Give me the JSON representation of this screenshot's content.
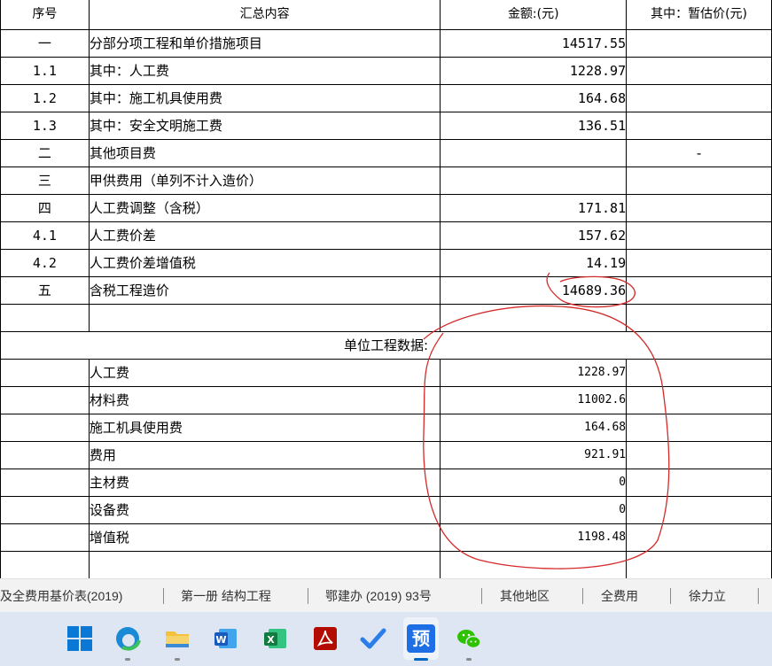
{
  "table": {
    "headers": [
      "序号",
      "汇总内容",
      "金额:(元)",
      "其中：暂估价(元)"
    ],
    "rows": [
      {
        "num": "一",
        "desc": "分部分项工程和单价措施项目",
        "amount": "14517.55",
        "est": ""
      },
      {
        "num": "1.1",
        "desc": "其中：人工费",
        "amount": "1228.97",
        "est": ""
      },
      {
        "num": "1.2",
        "desc": "其中：施工机具使用费",
        "amount": "164.68",
        "est": ""
      },
      {
        "num": "1.3",
        "desc": "其中：安全文明施工费",
        "amount": "136.51",
        "est": ""
      },
      {
        "num": "二",
        "desc": "其他项目费",
        "amount": "",
        "est": "-"
      },
      {
        "num": "三",
        "desc": "甲供费用（单列不计入造价）",
        "amount": "",
        "est": ""
      },
      {
        "num": "四",
        "desc": "人工费调整（含税）",
        "amount": "171.81",
        "est": ""
      },
      {
        "num": "4.1",
        "desc": "人工费价差",
        "amount": "157.62",
        "est": ""
      },
      {
        "num": "4.2",
        "desc": "人工费价差增值税",
        "amount": "14.19",
        "est": ""
      },
      {
        "num": "五",
        "desc": "含税工程造价",
        "amount": "14689.36",
        "est": ""
      }
    ],
    "unit_title": "单位工程数据:",
    "unit_rows": [
      {
        "desc": "人工费",
        "amount": "1228.97"
      },
      {
        "desc": "材料费",
        "amount": "11002.6"
      },
      {
        "desc": "施工机具使用费",
        "amount": "164.68"
      },
      {
        "desc": "费用",
        "amount": "921.91"
      },
      {
        "desc": "主材费",
        "amount": "0"
      },
      {
        "desc": "设备费",
        "amount": "0"
      },
      {
        "desc": "增值税",
        "amount": "1198.48"
      }
    ]
  },
  "status_bar": {
    "items": [
      "及全费用基价表(2019)",
      "第一册 结构工程",
      "鄂建办 (2019) 93号",
      "其他地区",
      "全费用",
      "徐力立"
    ]
  },
  "taskbar": {
    "preview_app_label": "预",
    "icons": [
      "windows-start-icon",
      "edge-browser-icon",
      "file-explorer-icon",
      "word-icon",
      "excel-icon",
      "acrobat-icon",
      "todo-check-icon",
      "preview-app-icon",
      "wechat-icon"
    ]
  },
  "colors": {
    "annotation_red": "#d42a2a",
    "taskbar_bg": "#dde6f2",
    "status_bg": "#f2f2f2"
  }
}
